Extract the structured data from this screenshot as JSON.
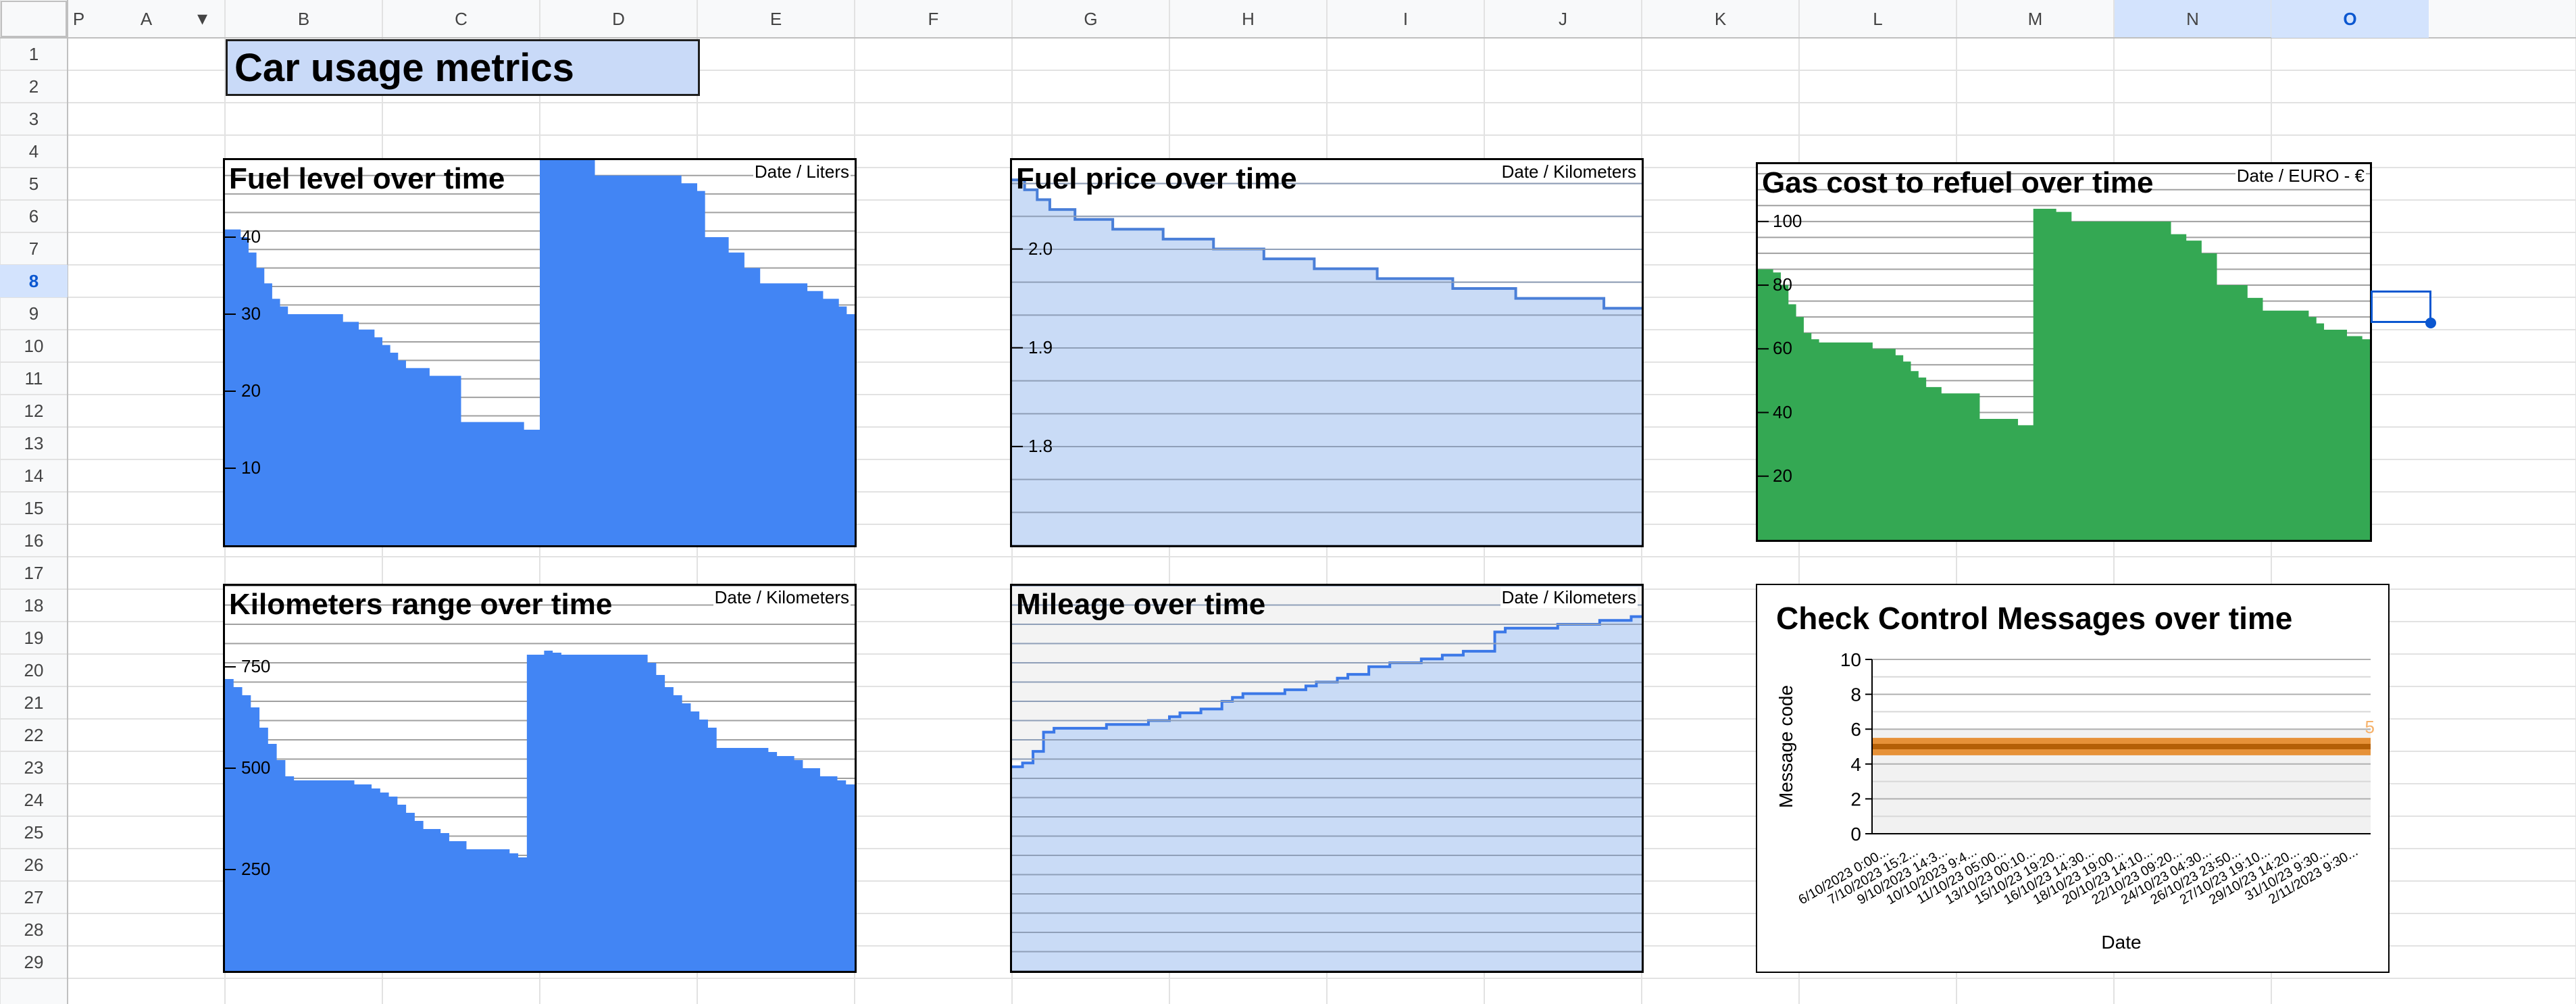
{
  "sheet": {
    "columns": [
      "A",
      "B",
      "C",
      "D",
      "E",
      "F",
      "G",
      "H",
      "I",
      "J",
      "K",
      "L",
      "M",
      "N",
      "O",
      "P"
    ],
    "rows": [
      "1",
      "2",
      "3",
      "4",
      "5",
      "6",
      "7",
      "8",
      "9",
      "10",
      "11",
      "12",
      "13",
      "14",
      "15",
      "16",
      "17",
      "18",
      "19",
      "20",
      "21",
      "22",
      "23",
      "24",
      "25",
      "26",
      "27",
      "28",
      "29"
    ],
    "selected_column": "O",
    "selected_row": "8",
    "title": "Car usage metrics",
    "colors": {
      "header_bg": "#f8f9fa",
      "selection": "#d3e3fd",
      "accent": "#0b57d0",
      "title_fill": "#c9daf8"
    }
  },
  "charts": {
    "fuel_level": {
      "title": "Fuel level over time",
      "unit": "Date / Liters",
      "yticks": [
        "40",
        "30",
        "20",
        "10"
      ],
      "chart_data": {
        "type": "area",
        "ylabel": "Liters",
        "ylim": [
          0,
          50
        ],
        "color": "#4285f4",
        "values": [
          41,
          41,
          40,
          38,
          36,
          34,
          32,
          31,
          30,
          30,
          30,
          30,
          30,
          30,
          30,
          29,
          29,
          28,
          28,
          27,
          26,
          25,
          24,
          23,
          23,
          23,
          22,
          22,
          22,
          22,
          16,
          16,
          16,
          16,
          16,
          16,
          16,
          16,
          15,
          15,
          50,
          50,
          50,
          50,
          50,
          50,
          50,
          48,
          48,
          48,
          48,
          48,
          48,
          48,
          48,
          48,
          48,
          48,
          47,
          47,
          46,
          40,
          40,
          40,
          38,
          38,
          36,
          36,
          34,
          34,
          34,
          34,
          34,
          34,
          33,
          33,
          32,
          32,
          31,
          30
        ]
      }
    },
    "fuel_price": {
      "title": "Fuel price over time",
      "unit": "Date / Kilometers",
      "yticks": [
        "2.0",
        "1.9",
        "1.8"
      ],
      "chart_data": {
        "type": "area",
        "ylabel": "Kilometers",
        "ylim": [
          1.7,
          2.09
        ],
        "color": "#c6d9f6",
        "line": "#4a7fd8",
        "values": [
          2.07,
          2.06,
          2.05,
          2.04,
          2.04,
          2.03,
          2.03,
          2.03,
          2.02,
          2.02,
          2.02,
          2.02,
          2.01,
          2.01,
          2.01,
          2.01,
          2.0,
          2.0,
          2.0,
          2.0,
          1.99,
          1.99,
          1.99,
          1.99,
          1.98,
          1.98,
          1.98,
          1.98,
          1.98,
          1.97,
          1.97,
          1.97,
          1.97,
          1.97,
          1.97,
          1.96,
          1.96,
          1.96,
          1.96,
          1.96,
          1.95,
          1.95,
          1.95,
          1.95,
          1.95,
          1.95,
          1.95,
          1.94,
          1.94,
          1.94
        ]
      }
    },
    "gas_cost": {
      "title": "Gas cost to refuel over time",
      "unit": "Date / EURO - €",
      "yticks": [
        "100",
        "80",
        "60",
        "40",
        "20"
      ],
      "chart_data": {
        "type": "area",
        "ylabel": "EURO - €",
        "ylim": [
          0,
          118
        ],
        "color": "#34a853",
        "values": [
          85,
          85,
          84,
          80,
          74,
          70,
          65,
          63,
          62,
          62,
          62,
          62,
          62,
          62,
          62,
          60,
          60,
          60,
          58,
          56,
          53,
          51,
          48,
          48,
          46,
          46,
          46,
          46,
          46,
          38,
          38,
          38,
          38,
          38,
          36,
          36,
          104,
          104,
          104,
          103,
          103,
          100,
          100,
          100,
          100,
          100,
          100,
          100,
          100,
          100,
          100,
          100,
          100,
          100,
          96,
          96,
          94,
          94,
          90,
          90,
          80,
          80,
          80,
          80,
          76,
          76,
          72,
          72,
          72,
          72,
          72,
          72,
          70,
          68,
          66,
          66,
          66,
          64,
          64,
          63
        ]
      }
    },
    "km_range": {
      "title": "Kilometers range over time",
      "unit": "Date / Kilometers",
      "yticks": [
        "750",
        "500",
        "250"
      ],
      "chart_data": {
        "type": "area",
        "ylabel": "Kilometers",
        "ylim": [
          0,
          950
        ],
        "color": "#4285f4",
        "values": [
          720,
          700,
          680,
          650,
          600,
          560,
          520,
          480,
          470,
          470,
          470,
          470,
          470,
          470,
          470,
          460,
          460,
          450,
          440,
          430,
          410,
          390,
          370,
          350,
          350,
          340,
          320,
          320,
          300,
          300,
          300,
          300,
          300,
          290,
          280,
          780,
          780,
          790,
          785,
          780,
          780,
          780,
          780,
          780,
          780,
          780,
          780,
          780,
          780,
          760,
          730,
          700,
          680,
          660,
          640,
          620,
          600,
          550,
          550,
          550,
          550,
          550,
          550,
          540,
          530,
          530,
          520,
          500,
          500,
          480,
          480,
          470,
          460
        ]
      }
    },
    "mileage": {
      "title": "Mileage over time",
      "unit": "Date / Kilometers",
      "yticks": [],
      "chart_data": {
        "type": "area",
        "ylabel": "Kilometers",
        "ylim": [
          0,
          100
        ],
        "color": "#c6d9f6",
        "line": "#3b78e7",
        "values": [
          53,
          54,
          57,
          62,
          63,
          63,
          63,
          63,
          63,
          64,
          64,
          64,
          64,
          65,
          65,
          66,
          67,
          67,
          68,
          68,
          70,
          71,
          72,
          72,
          72,
          72,
          73,
          73,
          74,
          75,
          75,
          76,
          77,
          77,
          79,
          79,
          80,
          80,
          80,
          81,
          81,
          82,
          82,
          83,
          83,
          83,
          88,
          89,
          89,
          89,
          89,
          89,
          90,
          90,
          90,
          90,
          91,
          91,
          91,
          92
        ]
      }
    },
    "ccm": {
      "title": "Check Control Messages over time",
      "ylabel": "Message code",
      "xlabel": "Date",
      "data_label": "5",
      "yticks": [
        "10",
        "8",
        "6",
        "4",
        "2",
        "0"
      ],
      "xticks": [
        "6/10/2023 0:00...",
        "7/10/2023 15:2...",
        "9/10/2023 14:3...",
        "10/10/2023 9:4...",
        "11/10/23 05:00...",
        "13/10/23 00:10...",
        "15/10/23 19:20...",
        "16/10/23 14:30...",
        "18/10/23 19:00...",
        "20/10/23 14:10...",
        "22/10/23 09:20...",
        "24/10/23 04:30...",
        "26/10/23 23:50...",
        "27/10/23 19:10...",
        "29/10/23 14:20...",
        "31/10/23 9:30...",
        "2/11/2023 9:30..."
      ],
      "chart_data": {
        "type": "line",
        "ylim": [
          0,
          10
        ],
        "series": [
          {
            "value": 5,
            "color": "#b45f06",
            "band": "#e69138"
          }
        ],
        "label_color": "#f6b26b"
      }
    }
  }
}
